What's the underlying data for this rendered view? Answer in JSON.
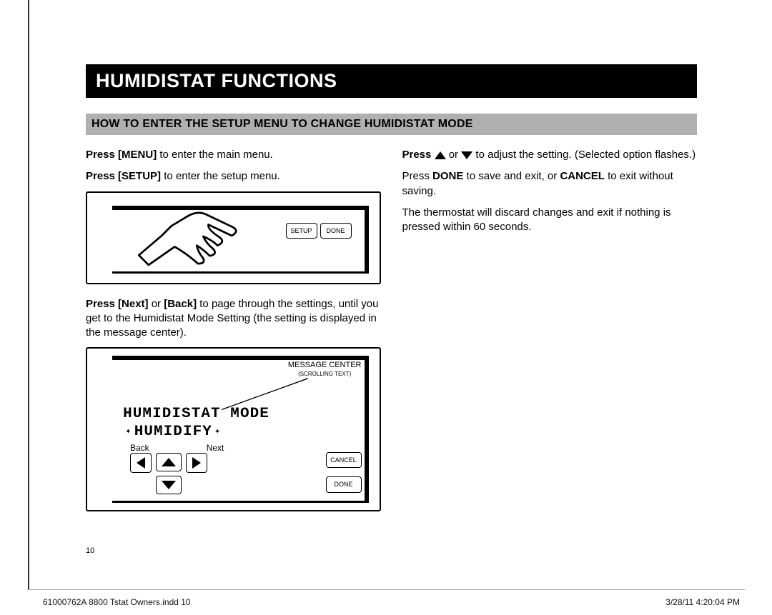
{
  "section_title": "HUMIDISTAT FUNCTIONS",
  "subtitle": "HOW TO ENTER THE SETUP MENU TO CHANGE HUMIDISTAT MODE",
  "left": {
    "p1_bold": "Press [MENU]",
    "p1_rest": " to enter the main menu.",
    "p2_bold": "Press [SETUP]",
    "p2_rest": " to enter the setup menu.",
    "p3_bold1": "Press [Next]",
    "p3_mid": " or ",
    "p3_bold2": "[Back]",
    "p3_rest": " to page through the settings, until you get to the Humidistat Mode Setting (the setting is displayed in the message center).",
    "ill1_setup": "SETUP",
    "ill1_done": "DONE",
    "ill2_msg_center": "MESSAGE CENTER",
    "ill2_msg_sub": "(SCROLLING TEXT)",
    "ill2_lcd_line1": "HUMIDISTAT MODE",
    "ill2_lcd_line2": "HUMIDIFY",
    "ill2_back": "Back",
    "ill2_next": "Next",
    "ill2_cancel": "CANCEL",
    "ill2_done": "DONE"
  },
  "right": {
    "p1_bold": "Press ",
    "p1_mid": " or ",
    "p1_rest": " to adjust the setting. (Selected option flashes.)",
    "p2_a": "Press ",
    "p2_done": "DONE",
    "p2_b": " to save and exit, or ",
    "p2_cancel": "CANCEL",
    "p2_c": " to exit without saving.",
    "p3": "The thermostat will discard changes and exit if nothing is pressed within 60 seconds."
  },
  "page_number": "10",
  "footer_left": "61000762A 8800 Tstat Owners.indd   10",
  "footer_right": "3/28/11   4:20:04 PM"
}
